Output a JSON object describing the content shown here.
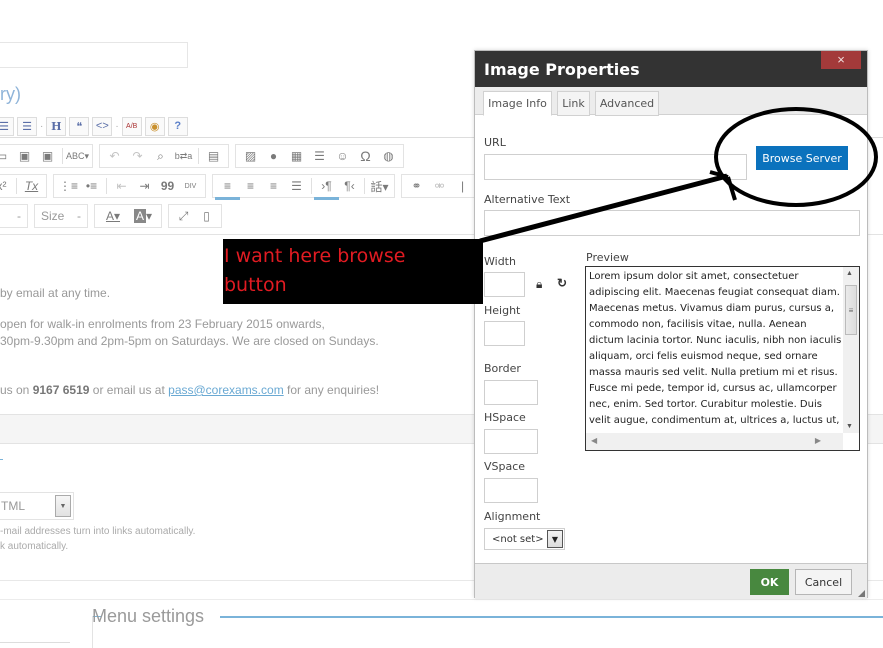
{
  "page": {
    "heading_fragment": "ry)",
    "small_toolbar": [
      {
        "icon": "list-icon",
        "glyph": "☰"
      },
      {
        "icon": "bulleted-list-icon",
        "glyph": "☰"
      },
      {
        "icon": "heading-icon",
        "glyph": "H"
      },
      {
        "icon": "blockquote-icon",
        "glyph": "❝"
      },
      {
        "icon": "code-icon",
        "glyph": "<>"
      },
      {
        "icon": "abbreviation-icon",
        "glyph": "A/B"
      },
      {
        "icon": "preview-eye-icon",
        "glyph": "👁"
      },
      {
        "icon": "help-icon",
        "glyph": "?"
      }
    ],
    "toolbar_row1": [
      {
        "icon": "paste-icon",
        "glyph": "📋"
      },
      {
        "icon": "paste-text-icon",
        "glyph": "T"
      },
      {
        "icon": "paste-word-icon",
        "glyph": "W"
      },
      {
        "icon": "spellcheck-icon",
        "glyph": "ABC▾"
      },
      {
        "icon": "undo-icon",
        "glyph": "↶"
      },
      {
        "icon": "redo-icon",
        "glyph": "↷"
      },
      {
        "icon": "find-icon",
        "glyph": "🔍"
      },
      {
        "icon": "replace-icon",
        "glyph": "b⇄a"
      },
      {
        "icon": "select-all-icon",
        "glyph": "▤"
      },
      {
        "icon": "image-icon",
        "glyph": "🖼"
      },
      {
        "icon": "flash-icon",
        "glyph": "●"
      },
      {
        "icon": "table-icon",
        "glyph": "▦"
      },
      {
        "icon": "horizontal-rule-icon",
        "glyph": "≡"
      },
      {
        "icon": "smiley-icon",
        "glyph": "☺"
      },
      {
        "icon": "special-char-icon",
        "glyph": "Ω"
      },
      {
        "icon": "iframe-icon",
        "glyph": "◍"
      }
    ],
    "toolbar_row2": [
      {
        "icon": "superscript-icon",
        "glyph": "x²"
      },
      {
        "icon": "remove-format-icon",
        "glyph": "Tx"
      },
      {
        "icon": "numbered-list-icon",
        "glyph": "⅓≡"
      },
      {
        "icon": "bulleted-list-icon",
        "glyph": "•≡"
      },
      {
        "icon": "outdent-icon",
        "glyph": "⇤"
      },
      {
        "icon": "indent-icon",
        "glyph": "⇥"
      },
      {
        "icon": "blockquote-icon",
        "glyph": "99"
      },
      {
        "icon": "div-icon",
        "glyph": "DIV"
      },
      {
        "icon": "align-left-icon",
        "glyph": "≡"
      },
      {
        "icon": "align-center-icon",
        "glyph": "≡"
      },
      {
        "icon": "align-right-icon",
        "glyph": "≡"
      },
      {
        "icon": "justify-icon",
        "glyph": "≡"
      },
      {
        "icon": "ltr-icon",
        "glyph": "›¶"
      },
      {
        "icon": "rtl-icon",
        "glyph": "¶‹"
      },
      {
        "icon": "language-icon",
        "glyph": "話▾"
      },
      {
        "icon": "link-icon",
        "glyph": "⊂⊃"
      },
      {
        "icon": "unlink-icon",
        "glyph": "⊄"
      }
    ],
    "toolbar_row3": {
      "font_combo": "",
      "size_combo": "Size",
      "text_color": "A",
      "bg_color": "A",
      "maximize": "⤢",
      "show_blocks": "▯"
    },
    "body_lines": [
      "by email at any time.",
      "open for walk-in enrolments from 23 February 2015 onwards,",
      "30pm-9.30pm and 2pm-5pm on Saturdays. We are closed on Sundays."
    ],
    "contact_line": {
      "prefix": "us on ",
      "phone": "9167 6519",
      "middle": " or email us at ",
      "email": "pass@corexams.com",
      "suffix": " for any enquiries!"
    },
    "text_format": "TML",
    "format_tips": [
      "-mail addresses turn into links automatically.",
      "k automatically."
    ],
    "menu_settings": "Menu settings"
  },
  "dialog": {
    "title": "Image Properties",
    "close_glyph": "×",
    "tabs": [
      {
        "label": "Image Info",
        "active": true
      },
      {
        "label": "Link",
        "active": false
      },
      {
        "label": "Advanced",
        "active": false
      }
    ],
    "url_label": "URL",
    "url_value": "",
    "browse_label": "Browse Server",
    "alt_label": "Alternative Text",
    "alt_value": "",
    "width_label": "Width",
    "width_value": "",
    "height_label": "Height",
    "height_value": "",
    "border_label": "Border",
    "border_value": "",
    "hspace_label": "HSpace",
    "hspace_value": "",
    "vspace_label": "VSpace",
    "vspace_value": "",
    "alignment_label": "Alignment",
    "alignment_value": "<not set>",
    "preview_label": "Preview",
    "preview_text": "Lorem ipsum dolor sit amet, consectetuer adipiscing elit. Maecenas feugiat consequat diam. Maecenas metus. Vivamus diam purus, cursus a, commodo non, facilisis vitae, nulla. Aenean dictum lacinia tortor. Nunc iaculis, nibh non iaculis aliquam, orci felis euismod neque, sed ornare massa mauris sed velit. Nulla pretium mi et risus. Fusce mi pede, tempor id, cursus ac, ullamcorper nec, enim. Sed tortor. Curabitur molestie. Duis velit augue, condimentum at, ultrices a, luctus ut,",
    "ok_label": "OK",
    "cancel_label": "Cancel"
  },
  "annotation": {
    "note_line1": "I want here browse",
    "note_line2": "button"
  },
  "colors": {
    "dialog_title_bg": "#333333",
    "close_bg": "#a33a3a",
    "browse_bg": "#0b72bd",
    "ok_bg": "#48883f",
    "annotation_text": "#e11b22",
    "link": "#6aa9d3"
  }
}
